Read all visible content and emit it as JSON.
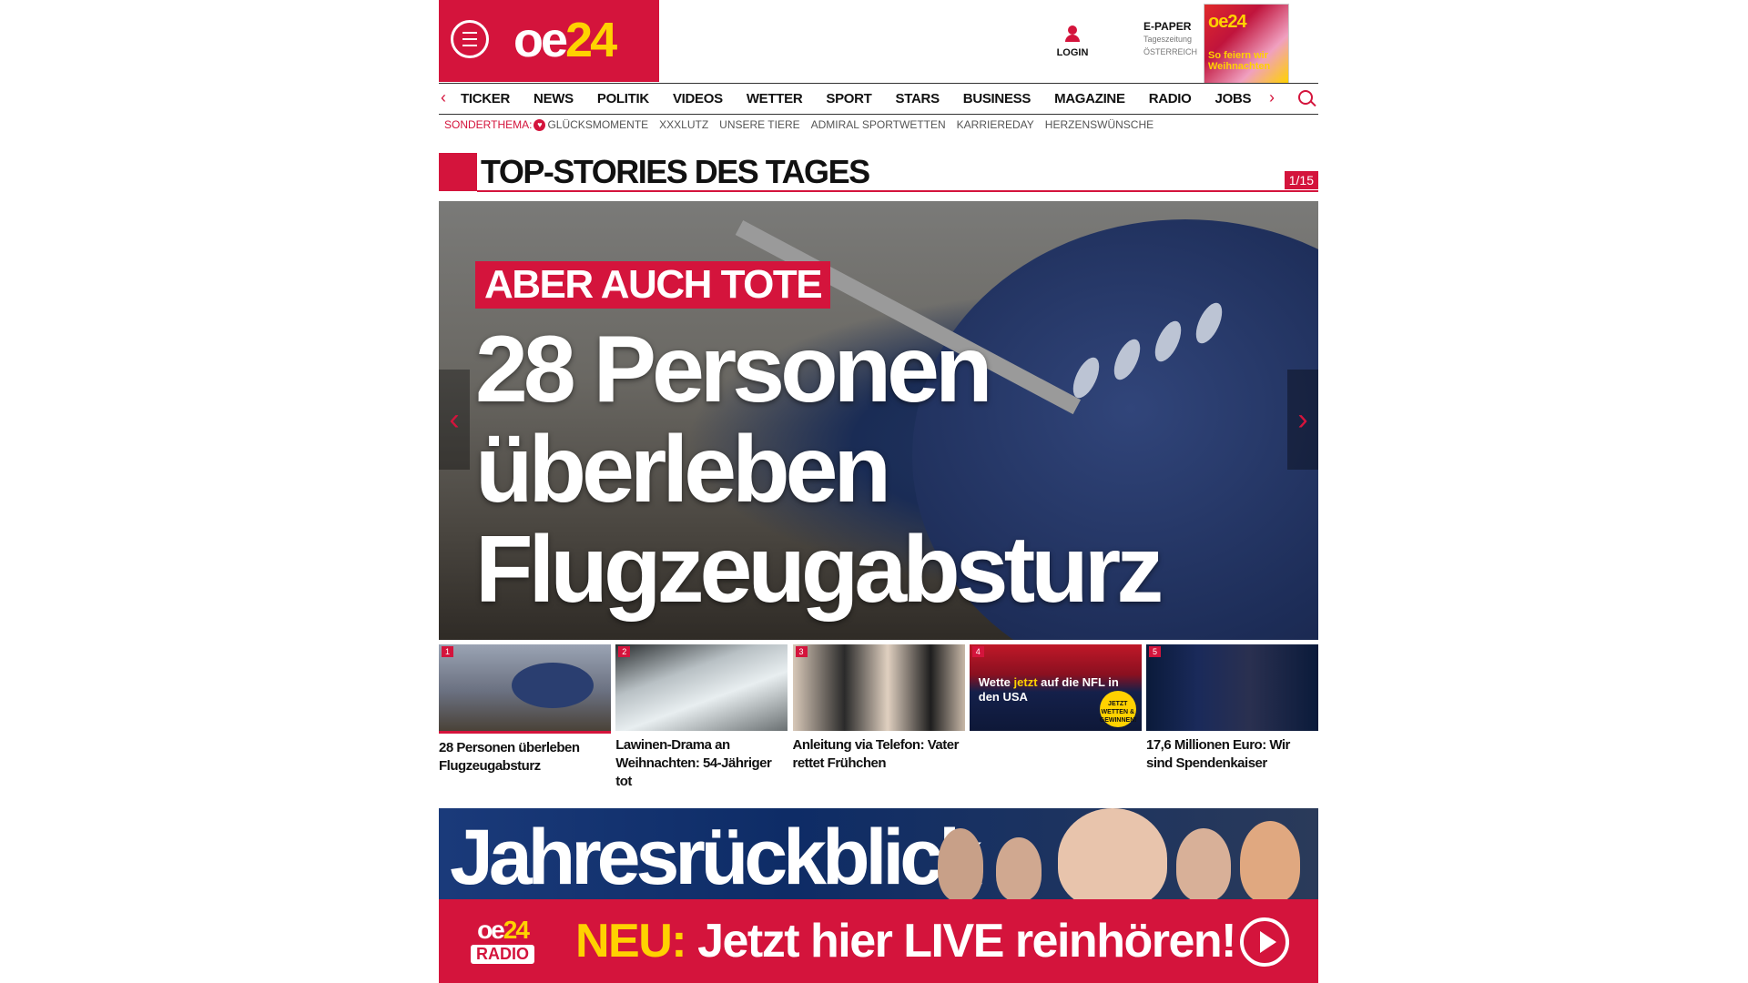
{
  "header": {
    "logo_left": "oe",
    "logo_right": "24",
    "login_label": "LOGIN",
    "epaper_title": "E-PAPER",
    "epaper_sub1": "Tageszeitung",
    "epaper_sub2": "ÖSTERREICH",
    "cover_logo": "oe24",
    "cover_headline": "So feiern wir Weihnachten"
  },
  "nav": {
    "items": [
      "TICKER",
      "NEWS",
      "POLITIK",
      "VIDEOS",
      "WETTER",
      "SPORT",
      "STARS",
      "BUSINESS",
      "MAGAZINE",
      "RADIO",
      "JOBS"
    ]
  },
  "subnav": {
    "label": "SONDERTHEMA:",
    "items": [
      "GLÜCKSMOMENTE",
      "XXXLUTZ",
      "UNSERE TIERE",
      "ADMIRAL SPORTWETTEN",
      "KARRIEREDAY",
      "HERZENSWÜNSCHE"
    ]
  },
  "section": {
    "title": "TOP-STORIES DES TAGES",
    "counter": "1/15"
  },
  "hero": {
    "kicker": "ABER AUCH TOTE",
    "headline": "28 Personen überleben Flugzeugabsturz"
  },
  "thumbs": [
    {
      "num": "1",
      "caption": "28 Personen überleben Flugzeugabsturz"
    },
    {
      "num": "2",
      "caption": "Lawinen-Drama an Weihnachten: 54-Jähriger tot"
    },
    {
      "num": "3",
      "caption": "Anleitung via Telefon: Vater rettet Frühchen"
    },
    {
      "num": "4",
      "caption": "",
      "ad_text_1": "Wette",
      "ad_text_2": "jetzt",
      "ad_text_3": "auf die NFL in den USA",
      "ad_badge": "JETZT WETTEN & GEWINNEN!"
    },
    {
      "num": "5",
      "caption": "17,6 Millionen Euro: Wir sind Spendenkaiser"
    }
  ],
  "banner": {
    "title": "Jahresrückblick",
    "radio_logo_left": "oe",
    "radio_logo_right": "24",
    "radio_logo_label": "RADIO",
    "neu": "NEU:",
    "cta": "Jetzt hier LIVE reinhören!"
  },
  "colors": {
    "brand_red": "#d4143c",
    "accent_yellow": "#ffd200"
  }
}
